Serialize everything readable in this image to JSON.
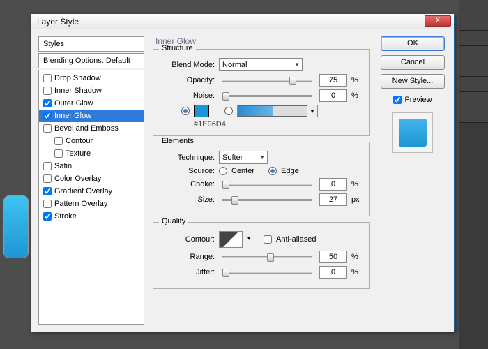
{
  "dialog": {
    "title": "Layer Style",
    "close": "X"
  },
  "styles": {
    "header": "Styles",
    "blending": "Blending Options: Default",
    "items": [
      {
        "label": "Drop Shadow",
        "checked": false,
        "sub": false
      },
      {
        "label": "Inner Shadow",
        "checked": false,
        "sub": false
      },
      {
        "label": "Outer Glow",
        "checked": true,
        "sub": false
      },
      {
        "label": "Inner Glow",
        "checked": true,
        "sub": false,
        "selected": true
      },
      {
        "label": "Bevel and Emboss",
        "checked": false,
        "sub": false
      },
      {
        "label": "Contour",
        "checked": false,
        "sub": true
      },
      {
        "label": "Texture",
        "checked": false,
        "sub": true
      },
      {
        "label": "Satin",
        "checked": false,
        "sub": false
      },
      {
        "label": "Color Overlay",
        "checked": false,
        "sub": false
      },
      {
        "label": "Gradient Overlay",
        "checked": true,
        "sub": false
      },
      {
        "label": "Pattern Overlay",
        "checked": false,
        "sub": false
      },
      {
        "label": "Stroke",
        "checked": true,
        "sub": false
      }
    ]
  },
  "panel": {
    "title": "Inner Glow",
    "structure": {
      "legend": "Structure",
      "blend_mode_label": "Blend Mode:",
      "blend_mode": "Normal",
      "opacity_label": "Opacity:",
      "opacity": "75",
      "opacity_unit": "%",
      "noise_label": "Noise:",
      "noise": "0",
      "noise_unit": "%",
      "color_hex": "#1E96D4"
    },
    "elements": {
      "legend": "Elements",
      "technique_label": "Technique:",
      "technique": "Softer",
      "source_label": "Source:",
      "source_center": "Center",
      "source_edge": "Edge",
      "choke_label": "Choke:",
      "choke": "0",
      "choke_unit": "%",
      "size_label": "Size:",
      "size": "27",
      "size_unit": "px"
    },
    "quality": {
      "legend": "Quality",
      "contour_label": "Contour:",
      "anti_label": "Anti-aliased",
      "range_label": "Range:",
      "range": "50",
      "range_unit": "%",
      "jitter_label": "Jitter:",
      "jitter": "0",
      "jitter_unit": "%"
    }
  },
  "buttons": {
    "ok": "OK",
    "cancel": "Cancel",
    "new_style": "New Style...",
    "preview": "Preview"
  }
}
